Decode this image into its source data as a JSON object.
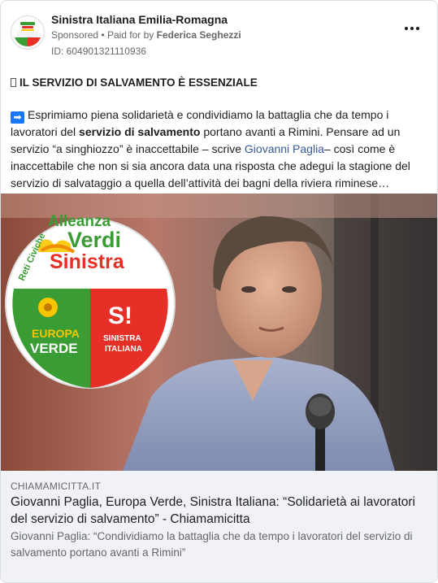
{
  "post": {
    "page_name": "Sinistra Italiana Emilia-Romagna",
    "sponsored_label": "Sponsored",
    "separator": "•",
    "paid_for_prefix": "Paid for by",
    "paid_for_name": "Federica Seghezzi",
    "ad_id": "ID: 604901321110936",
    "more_icon": "more-horizontal-icon",
    "headline_icon": "",
    "headline": "IL SERVIZIO DI SALVAMENTO È ESSENZIALE",
    "body": {
      "arrow_icon": "➡",
      "t1": "Esprimiamo piena solidarietà e condividiamo la battaglia che da tempo i lavoratori del ",
      "t1_bold": "servizio di salvamento",
      "t2": " portano avanti a Rimini. Pensare ad un servizio “a singhiozzo” è inaccettabile – scrive ",
      "mention": "Giovanni Paglia",
      "t3": "– così come è inaccettabile che non si sia ancora data una risposta che adegui la stagione del servizio di salvataggio a quella dell’attività dei bagni della riviera riminese…"
    },
    "image": {
      "logo": {
        "line1": "Alleanza",
        "line2": "Verdi",
        "line3": "Sinistra",
        "side_text": "Reti Civiche",
        "left_text1": "EUROPA",
        "left_text2": "VERDE",
        "right_symbol": "S!",
        "right_text1": "SINISTRA",
        "right_text2": "ITALIANA",
        "colors": {
          "green": "#3a9c35",
          "red": "#e63027",
          "yellow": "#f7c600",
          "orange": "#f08a00"
        }
      }
    },
    "link": {
      "domain": "CHIAMAMICITTA.IT",
      "title": "Giovanni Paglia, Europa Verde, Sinistra Italiana: “Solidarietà ai lavoratori del servizio di salvamento” - Chiamamicitta",
      "description": "Giovanni Paglia: “Condividiamo la battaglia che da tempo i lavoratori del servizio di salvamento portano avanti a Rimini”"
    }
  }
}
